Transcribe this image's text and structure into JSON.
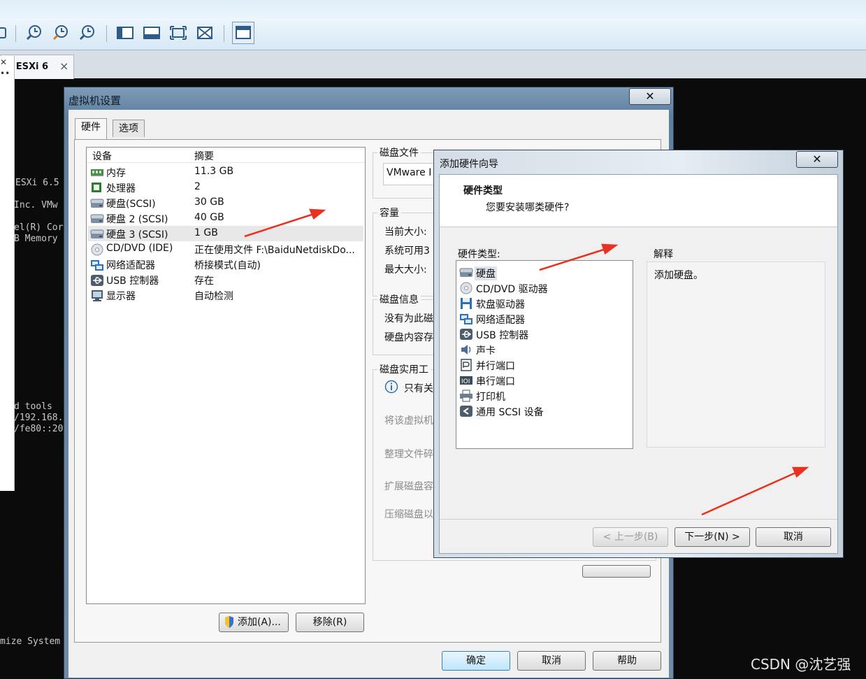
{
  "host": {
    "tab": {
      "title": "re ESXi 6",
      "close": "×"
    },
    "console_lines": [
      "ESXi 6.5",
      "Inc. VMw",
      "el(R) Cor",
      "B Memory",
      "d tools",
      "/192.168.",
      "/fe80::20",
      "mize System"
    ]
  },
  "vm_settings": {
    "title": "虚拟机设置",
    "close": "✕",
    "tabs": [
      "硬件",
      "选项"
    ],
    "columns": {
      "device": "设备",
      "summary": "摘要"
    },
    "devices": [
      {
        "name": "内存",
        "summary": "11.3 GB",
        "icon": "memory-icon"
      },
      {
        "name": "处理器",
        "summary": "2",
        "icon": "cpu-icon"
      },
      {
        "name": "硬盘(SCSI)",
        "summary": "30 GB",
        "icon": "hard-disk-icon"
      },
      {
        "name": "硬盘 2 (SCSI)",
        "summary": "40 GB",
        "icon": "hard-disk-icon"
      },
      {
        "name": "硬盘 3 (SCSI)",
        "summary": "1 GB",
        "icon": "hard-disk-icon"
      },
      {
        "name": "CD/DVD (IDE)",
        "summary": "正在使用文件 F:\\BaiduNetdiskDo...",
        "icon": "cd-dvd-icon"
      },
      {
        "name": "网络适配器",
        "summary": "桥接模式(自动)",
        "icon": "network-adapter-icon"
      },
      {
        "name": "USB 控制器",
        "summary": "存在",
        "icon": "usb-icon"
      },
      {
        "name": "显示器",
        "summary": "自动检测",
        "icon": "monitor-icon"
      }
    ],
    "add_button": "添加(A)...",
    "remove_button": "移除(R)",
    "ok_button": "确定",
    "cancel_button": "取消",
    "help_button": "帮助",
    "disk_file": {
      "label": "磁盘文件",
      "value": "VMware I"
    },
    "capacity": {
      "label": "容量",
      "current": "当前大小:",
      "available": "系统可用3",
      "max": "最大大小:"
    },
    "disk_info": {
      "label": "磁盘信息",
      "line1": "没有为此磁",
      "line2": "硬盘内容存"
    },
    "utilities": {
      "label": "磁盘实用工",
      "info": "只有关",
      "items": [
        "将该虚拟机",
        "整理文件碎",
        "扩展磁盘容",
        "压缩磁盘以"
      ]
    }
  },
  "wizard": {
    "title": "添加硬件向导",
    "close": "✕",
    "heading": "硬件类型",
    "subheading": "您要安装哪类硬件?",
    "list_label": "硬件类型:",
    "items": [
      {
        "name": "硬盘",
        "icon": "hard-disk-icon"
      },
      {
        "name": "CD/DVD 驱动器",
        "icon": "cd-dvd-icon"
      },
      {
        "name": "软盘驱动器",
        "icon": "floppy-icon"
      },
      {
        "name": "网络适配器",
        "icon": "network-adapter-icon"
      },
      {
        "name": "USB 控制器",
        "icon": "usb-icon"
      },
      {
        "name": "声卡",
        "icon": "speaker-icon"
      },
      {
        "name": "并行端口",
        "icon": "parallel-port-icon"
      },
      {
        "name": "串行端口",
        "icon": "serial-port-icon"
      },
      {
        "name": "打印机",
        "icon": "printer-icon"
      },
      {
        "name": "通用 SCSI 设备",
        "icon": "scsi-icon"
      }
    ],
    "explain_label": "解释",
    "explain_text": "添加硬盘。",
    "back_button": "< 上一步(B)",
    "next_button": "下一步(N) >",
    "cancel_button": "取消"
  },
  "watermark": "CSDN @沈艺强"
}
